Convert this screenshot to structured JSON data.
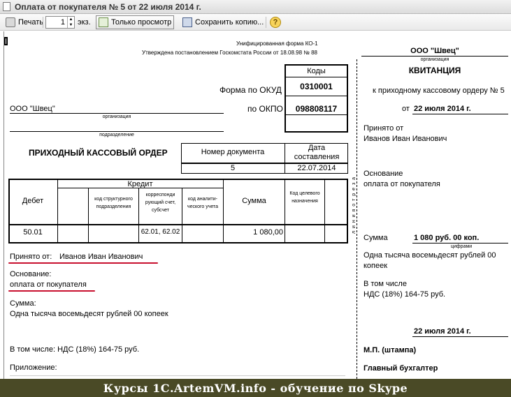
{
  "window": {
    "title": "Оплата от покупателя № 5 от 22 июля 2014 г."
  },
  "toolbar": {
    "print_label": "Печать",
    "copies_value": "1",
    "copies_unit": "экз.",
    "view_only_label": "Только просмотр",
    "save_copy_label": "Сохранить копию...",
    "help_label": "?"
  },
  "order": {
    "form_header_1": "Унифицированная форма КО-1",
    "form_header_2": "Утверждена постановлением Госкомстата России от 18.08.98 № 88",
    "codes_label": "Коды",
    "okud_label": "Форма по ОКУД",
    "okud_value": "0310001",
    "okpo_label": "по ОКПО",
    "okpo_value": "098808117",
    "organization": "ООО \"Швец\"",
    "organization_caption": "организация",
    "subdivision_caption": "подразделение",
    "title": "ПРИХОДНЫЙ КАССОВЫЙ ОРДЕР",
    "doc_number_header": "Номер документа",
    "doc_date_header": "Дата составления",
    "doc_number": "5",
    "doc_date": "22.07.2014",
    "table": {
      "debit_header": "Дебет",
      "credit_header": "Кредит",
      "col_struct": "код структурного подразделения",
      "col_corr": "корреспонди рующий счет, субсчет",
      "col_analytic": "код аналити- ческого учета",
      "sum_header": "Сумма",
      "target_code_header": "Код целевого назначения",
      "row": {
        "debit": "50.01",
        "corr": "62.01, 62.02",
        "sum": "1 080,00"
      }
    },
    "received_from_label": "Принято от:",
    "received_from": "Иванов Иван Иванович",
    "basis_label": "Основание:",
    "basis": "оплата от покупателя",
    "sum_label": "Сумма:",
    "sum_words": "Одна тысяча восемьдесят рублей 00 копеек",
    "including": "В том числе: НДС (18%) 164-75 руб.",
    "attachment_label": "Приложение:"
  },
  "receipt": {
    "organization": "ООО \"Швец\"",
    "organization_caption": "организация",
    "title": "КВИТАНЦИЯ",
    "to_order": "к приходному кассовому ордеру № 5",
    "date_prefix": "от",
    "date": "22 июля 2014 г.",
    "received_label": "Принято от",
    "received_from": "Иванов Иван Иванович",
    "basis_label": "Основание",
    "basis": "оплата от покупателя",
    "sum_label": "Сумма",
    "sum_figures": "1 080 руб. 00 коп.",
    "sum_caption": "цифрами",
    "sum_words_1": "Одна тысяча восемьдесят рублей 00",
    "sum_words_2": "копеек",
    "including_label": "В том числе",
    "including": "НДС (18%) 164-75 руб.",
    "date_bottom": "22 июля 2014 г.",
    "stamp": "М.П. (штампа)",
    "chief_accountant": "Главный бухгалтер"
  },
  "cut_line": "л и н и я   о т р е з а",
  "banner": "Курсы 1С.ArtemVM.info - обучение по Skype",
  "colors": {
    "underline": "#c8102e",
    "banner_bg": "#4a4a26"
  }
}
